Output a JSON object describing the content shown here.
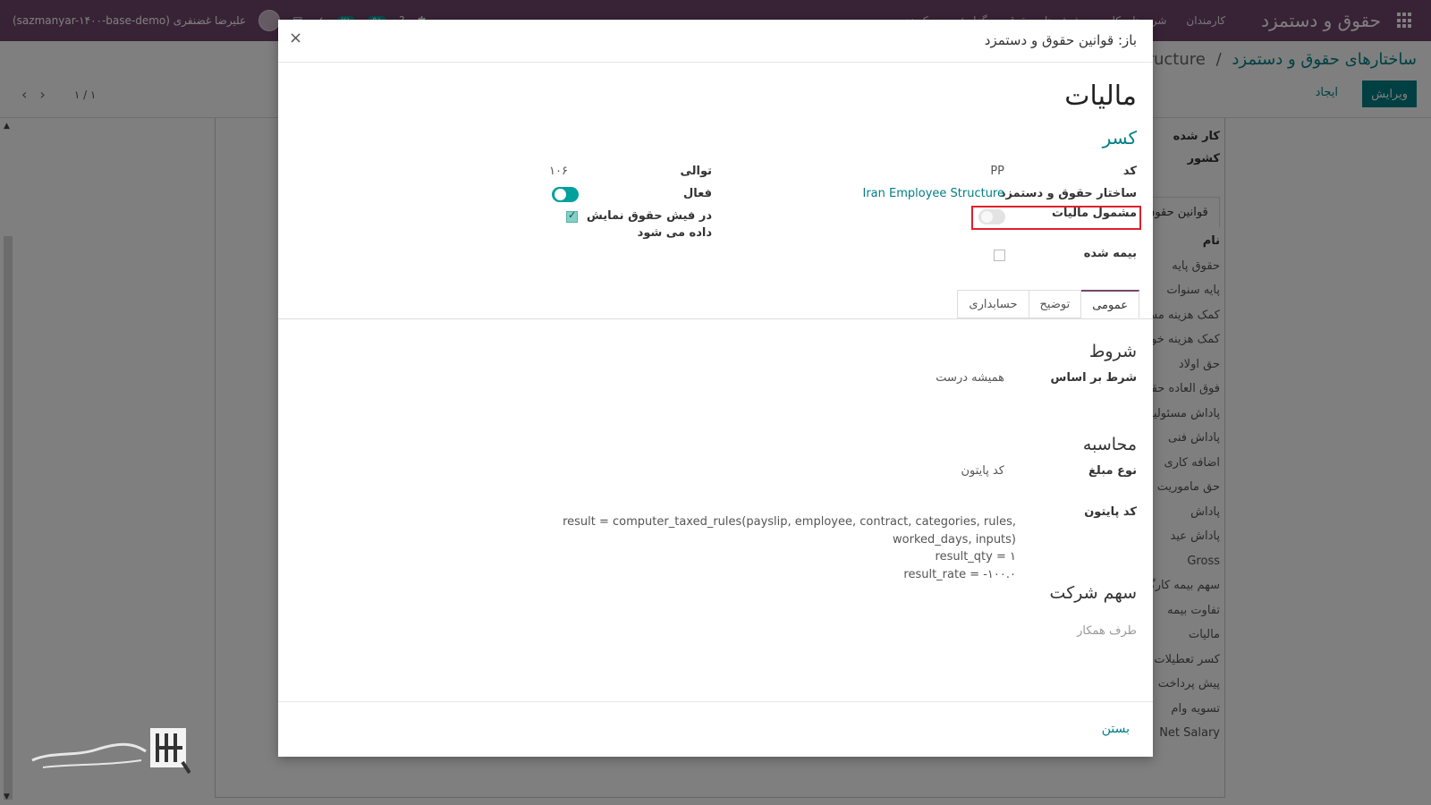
{
  "navbar": {
    "brand": "حقوق و دستمزد",
    "menu": [
      "کارمندان",
      "شرح های کاری",
      "فیش های حقوق",
      "گزارش",
      "پیکربندی"
    ],
    "user": "(sazmanyar-۱۴۰۰-base-demo) علیرضا غضنفری",
    "badge1": "۷۱",
    "badge2": "۹۱"
  },
  "breadcrumb": {
    "parent": "ساختارهای حقوق و دستمزد",
    "separator": "/",
    "current": "Structure"
  },
  "control": {
    "edit_label": "ویرایش",
    "create_label": "ایجاد",
    "pager": "۱ / ۱"
  },
  "background": {
    "fields": [
      "کار شده",
      "کشور"
    ],
    "tab_label": "قوانین حقوق",
    "list_header": "نام",
    "list": [
      "حقوق پایه",
      "پایه سنوات",
      "کمک هزینه مسکن",
      "کمک هزینه خوار",
      "حق اولاد",
      "فوق العاده حقوق",
      "پاداش مسئولیت",
      "پاداش فنی",
      "اضافه کاری",
      "حق ماموریت",
      "پاداش",
      "پاداش عید",
      "Gross",
      "سهم بیمه کارگر",
      "تفاوت بیمه",
      "مالیات",
      "کسر تعطیلات",
      "پیش پرداخت",
      "تسویه وام",
      "Net Salary"
    ]
  },
  "modal": {
    "title": "باز: قوانین حقوق و دستمزد",
    "close_symbol": "×",
    "record_name": "مالیات",
    "category": "کسر",
    "fields": {
      "code_label": "کد",
      "code_value": "PP",
      "structure_label": "ساختار حقوق و دستمزد",
      "structure_value": "Iran Employee Structure",
      "taxable_label": "مشمول مالیات",
      "insured_label": "بیمه شده",
      "sequence_label": "توالی",
      "sequence_value": "۱۰۶",
      "active_label": "فعال",
      "appears_label_1": "در فیش حقوق نمایش",
      "appears_label_2": "داده می شود"
    },
    "tabs": [
      "عمومی",
      "توضیح",
      "حسابداری"
    ],
    "conditions": {
      "title": "شروط",
      "label": "شرط بر اساس",
      "value": "همیشه درست"
    },
    "computation": {
      "title": "محاسبه",
      "amount_type_label": "نوع مبلغ",
      "amount_type_value": "کد پایتون",
      "python_label": "کد پایتون",
      "code_lines": [
        "result = computer_taxed_rules(payslip, employee, contract, categories, rules, worked_days, inputs)",
        "result_qty = ۱",
        "result_rate = -۱۰۰.۰"
      ]
    },
    "company": {
      "title": "سهم شرکت",
      "placeholder": "طرف همکار"
    },
    "footer_close": "بستن"
  },
  "colors": {
    "navbar": "#71476c",
    "accent": "#017e84",
    "toggle_on": "#00a09d",
    "highlight": "#e0202c"
  },
  "icons": [
    "apps-grid-icon",
    "close-icon",
    "chevron-left-icon",
    "chevron-right-icon",
    "toggle-icon",
    "checkbox-icon"
  ]
}
